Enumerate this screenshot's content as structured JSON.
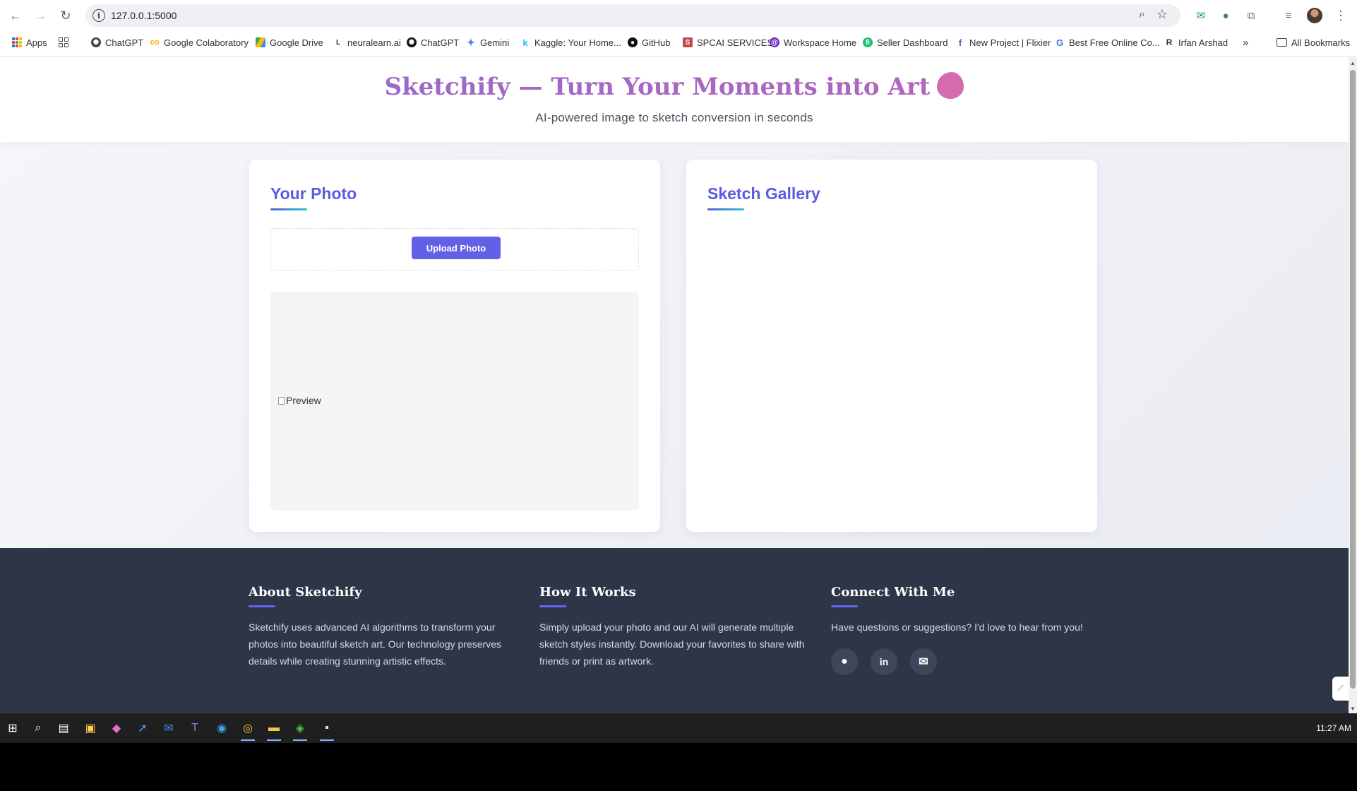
{
  "browser": {
    "url": "127.0.0.1:5000",
    "bookmarks": [
      {
        "label": "Apps",
        "icon": "apps-grid-icon"
      },
      {
        "label": "",
        "icon": "tab-groups-icon"
      },
      {
        "label": "ChatGPT",
        "icon": "openai-icon"
      },
      {
        "label": "Google Colaboratory",
        "icon": "colab-icon"
      },
      {
        "label": "Google Drive",
        "icon": "drive-icon"
      },
      {
        "label": "neuralearn.ai",
        "icon": "neuralearn-icon"
      },
      {
        "label": "ChatGPT",
        "icon": "openai-icon"
      },
      {
        "label": "Gemini",
        "icon": "gemini-icon"
      },
      {
        "label": "Kaggle: Your Home...",
        "icon": "kaggle-icon"
      },
      {
        "label": "GitHub",
        "icon": "github-icon"
      },
      {
        "label": "SPCAI SERVICES",
        "icon": "spcai-icon"
      },
      {
        "label": "Workspace Home",
        "icon": "workspace-icon"
      },
      {
        "label": "Seller Dashboard",
        "icon": "fiverr-icon"
      },
      {
        "label": "New Project | Flixier",
        "icon": "flixier-icon"
      },
      {
        "label": "Best Free Online Co...",
        "icon": "g-icon"
      },
      {
        "label": "Irfan Arshad",
        "icon": "researchgate-icon"
      }
    ],
    "overflow_label": "»",
    "all_bookmarks_label": "All Bookmarks"
  },
  "hero": {
    "title": "Sketchify — Turn Your Moments into Art",
    "subtitle": "AI-powered image to sketch conversion in seconds"
  },
  "upload_card": {
    "title": "Your Photo",
    "upload_button": "Upload Photo",
    "preview_alt": "Preview"
  },
  "gallery_card": {
    "title": "Sketch Gallery"
  },
  "footer": {
    "about": {
      "title": "About Sketchify",
      "text": "Sketchify uses advanced AI algorithms to transform your photos into beautiful sketch art. Our technology preserves details while creating stunning artistic effects."
    },
    "how": {
      "title": "How It Works",
      "text": "Simply upload your photo and our AI will generate multiple sketch styles instantly. Download your favorites to share with friends or print as artwork."
    },
    "connect": {
      "title": "Connect With Me",
      "text": "Have questions or suggestions? I'd love to hear from you!",
      "social": [
        "github-icon",
        "linkedin-icon",
        "email-icon"
      ]
    }
  },
  "taskbar": {
    "clock": "11:27 AM"
  },
  "colors": {
    "accent": "#6160e6",
    "title_gradient_start": "#8e6ccf",
    "title_gradient_end": "#c063b8",
    "footer_bg": "#2d3547"
  }
}
